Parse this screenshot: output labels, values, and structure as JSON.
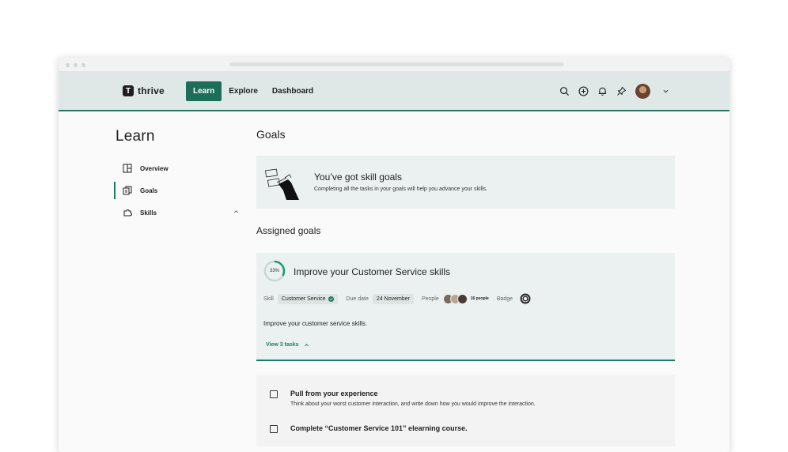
{
  "app": {
    "logo_letter": "T",
    "logo_text": "thrive"
  },
  "topnav": {
    "links": [
      "Learn",
      "Explore",
      "Dashboard"
    ],
    "active": "Learn",
    "icons": [
      "search-icon",
      "add-icon",
      "bell-icon",
      "pin-icon",
      "avatar",
      "chevron-down-icon"
    ]
  },
  "sidebar": {
    "title": "Learn",
    "items": [
      {
        "label": "Overview",
        "icon": "overview-icon"
      },
      {
        "label": "Goals",
        "icon": "goals-icon",
        "active": true
      },
      {
        "label": "Skills",
        "icon": "skills-icon",
        "expanded": true
      }
    ]
  },
  "main": {
    "title": "Goals",
    "banner": {
      "title": "You’ve got skill goals",
      "subtitle": "Completing all the tasks in your goals will help you advance your skills."
    },
    "assigned_title": "Assigned goals",
    "goal": {
      "progress_label": "33%",
      "progress": 0.33,
      "title": "Improve your Customer Service skills",
      "skill_label": "Skill",
      "skill_value": "Customer Service",
      "due_label": "Due date",
      "due_value": "24 November",
      "people_label": "People",
      "people_count": "16 people",
      "badge_label": "Badge",
      "description": "Improve your customer service skills.",
      "view_tasks": "View 3 tasks"
    },
    "tasks": [
      {
        "title": "Pull from your experience",
        "subtitle": "Think about your worst customer interaction, and write down how you would improve the interaction."
      },
      {
        "title": "Complete “Customer Service 101” elearning course.",
        "subtitle": ""
      }
    ]
  },
  "colors": {
    "accent": "#1c7a63",
    "accent_dark": "#1c6e58",
    "nav_bg": "#dfe8e6",
    "card_bg": "#eaf1f0"
  }
}
